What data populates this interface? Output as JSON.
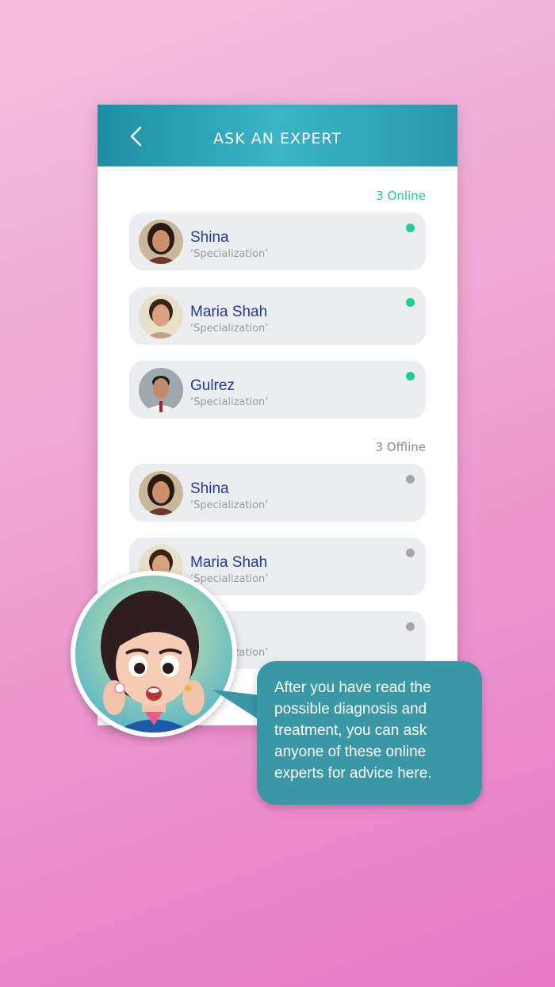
{
  "header": {
    "title": "ASK AN EXPERT",
    "back_icon": "chevron-left-icon"
  },
  "online": {
    "label": "3 Online",
    "color": "#1fcf8e",
    "experts": [
      {
        "name": "Shina",
        "specialization": "‘Specialization’",
        "status": "online"
      },
      {
        "name": "Maria Shah",
        "specialization": "‘Specialization’",
        "status": "online"
      },
      {
        "name": "Gulrez",
        "specialization": "‘Specialization’",
        "status": "online"
      }
    ]
  },
  "offline": {
    "label": "3 Offline",
    "color": "#a7a7a7",
    "experts": [
      {
        "name": "Shina",
        "specialization": "‘Specialization’",
        "status": "offline"
      },
      {
        "name": "Maria Shah",
        "specialization": "‘Specialization’",
        "status": "offline"
      },
      {
        "name": "",
        "specialization": "‘Specialization’",
        "status": "offline"
      }
    ]
  },
  "tooltip": {
    "text": "After you have read the possible diagnosis and treatment, you can ask anyone of these online experts for advice here."
  },
  "colors": {
    "header": "#2ba4b8",
    "name": "#223a93",
    "bubble": "#3a97a6",
    "background": "#ef9fd2"
  }
}
